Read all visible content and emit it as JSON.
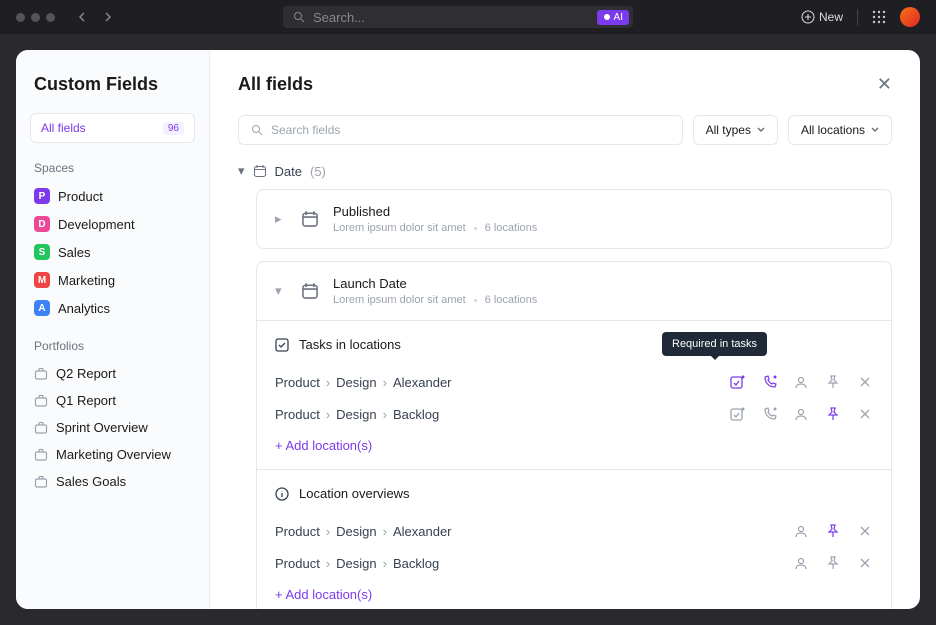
{
  "topbar": {
    "search_placeholder": "Search...",
    "ai_label": "AI",
    "new_label": "New"
  },
  "sidebar": {
    "title": "Custom Fields",
    "filter": {
      "label": "All fields",
      "count": "96"
    },
    "spaces_label": "Spaces",
    "spaces": [
      {
        "initial": "P",
        "label": "Product",
        "color": "#7c3aed"
      },
      {
        "initial": "D",
        "label": "Development",
        "color": "#ec4899"
      },
      {
        "initial": "S",
        "label": "Sales",
        "color": "#22c55e"
      },
      {
        "initial": "M",
        "label": "Marketing",
        "color": "#ef4444"
      },
      {
        "initial": "A",
        "label": "Analytics",
        "color": "#3b82f6"
      }
    ],
    "portfolios_label": "Portfolios",
    "portfolios": [
      {
        "label": "Q2 Report"
      },
      {
        "label": "Q1 Report"
      },
      {
        "label": "Sprint Overview"
      },
      {
        "label": "Marketing Overview"
      },
      {
        "label": "Sales Goals"
      }
    ]
  },
  "main": {
    "title": "All fields",
    "search_placeholder": "Search fields",
    "dropdown1": "All types",
    "dropdown2": "All locations",
    "group_name": "Date",
    "group_count": "(5)",
    "fields": [
      {
        "name": "Published",
        "desc": "Lorem ipsum dolor sit amet",
        "locations": "6 locations"
      },
      {
        "name": "Launch Date",
        "desc": "Lorem ipsum dolor sit amet",
        "locations": "6 locations"
      }
    ],
    "panel1_title": "Tasks in locations",
    "panel2_title": "Location overviews",
    "rows_tasks": [
      {
        "p1": "Product",
        "p2": "Design",
        "p3": "Alexander"
      },
      {
        "p1": "Product",
        "p2": "Design",
        "p3": "Backlog"
      }
    ],
    "rows_overview": [
      {
        "p1": "Product",
        "p2": "Design",
        "p3": "Alexander"
      },
      {
        "p1": "Product",
        "p2": "Design",
        "p3": "Backlog"
      }
    ],
    "add_location_label": "+ Add location(s)",
    "tooltip": "Required in tasks"
  }
}
